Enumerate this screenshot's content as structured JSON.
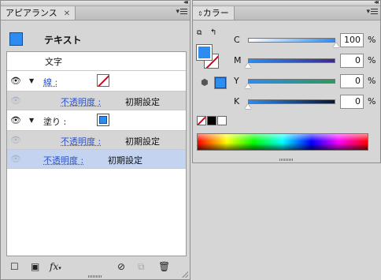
{
  "appearance": {
    "tab_title": "アピアランス",
    "object_type": "テキスト",
    "rows": {
      "characters": "文字",
      "stroke_label": "線 :",
      "stroke_opacity_label": "不透明度 :",
      "stroke_opacity_value": "初期設定",
      "fill_label": "塗り :",
      "fill_opacity_label": "不透明度 :",
      "fill_opacity_value": "初期設定",
      "opacity_label": "不透明度 :",
      "opacity_value": "初期設定"
    },
    "bottom_icons": [
      "add-stroke-icon",
      "add-fill-icon",
      "fx-icon",
      "clear-icon",
      "duplicate-icon",
      "delete-icon"
    ],
    "fx_label": "fx"
  },
  "color_panel": {
    "tab_title": "カラー",
    "mode": "CMYK",
    "sliders": [
      {
        "label": "C",
        "value": "100",
        "percent": 100
      },
      {
        "label": "M",
        "value": "0",
        "percent": 0
      },
      {
        "label": "Y",
        "value": "0",
        "percent": 0
      },
      {
        "label": "K",
        "value": "0",
        "percent": 0
      }
    ],
    "unit": "%"
  },
  "colors": {
    "fill": "#2d8cf0",
    "selection": "#c4d4f0",
    "link": "#2c53c8",
    "none_slash": "#d0021b"
  }
}
